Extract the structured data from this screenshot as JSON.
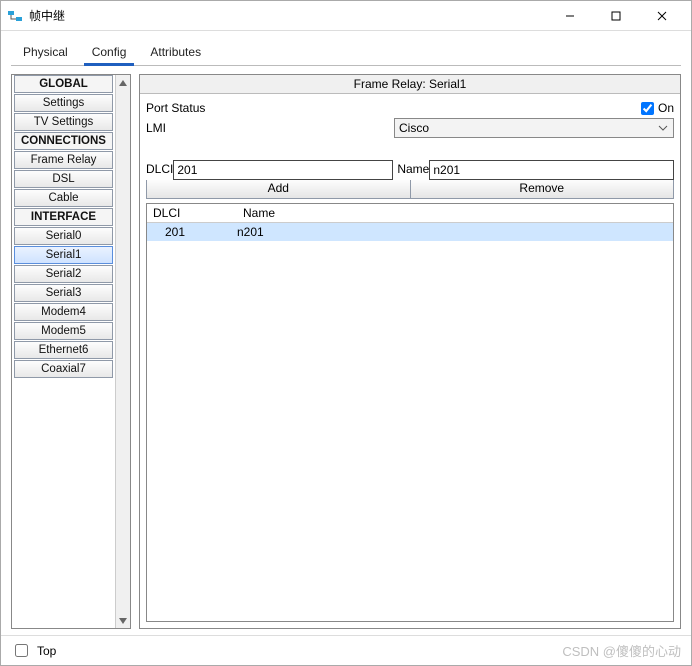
{
  "window": {
    "title": "帧中继"
  },
  "tabs": {
    "physical": "Physical",
    "config": "Config",
    "attributes": "Attributes",
    "active": "Config"
  },
  "sidebar": {
    "items": [
      {
        "kind": "header",
        "label": "GLOBAL"
      },
      {
        "kind": "item",
        "label": "Settings"
      },
      {
        "kind": "item",
        "label": "TV Settings"
      },
      {
        "kind": "header",
        "label": "CONNECTIONS"
      },
      {
        "kind": "item",
        "label": "Frame Relay"
      },
      {
        "kind": "item",
        "label": "DSL"
      },
      {
        "kind": "item",
        "label": "Cable"
      },
      {
        "kind": "header",
        "label": "INTERFACE"
      },
      {
        "kind": "item",
        "label": "Serial0"
      },
      {
        "kind": "item",
        "label": "Serial1",
        "selected": true
      },
      {
        "kind": "item",
        "label": "Serial2"
      },
      {
        "kind": "item",
        "label": "Serial3"
      },
      {
        "kind": "item",
        "label": "Modem4"
      },
      {
        "kind": "item",
        "label": "Modem5"
      },
      {
        "kind": "item",
        "label": "Ethernet6"
      },
      {
        "kind": "item",
        "label": "Coaxial7"
      }
    ]
  },
  "panel": {
    "title": "Frame Relay: Serial1",
    "port_status_label": "Port Status",
    "on_label": "On",
    "port_status_on": true,
    "lmi_label": "LMI",
    "lmi_value": "Cisco",
    "dlci_label": "DLCI",
    "dlci_value": "201",
    "name_label": "Name",
    "name_value": "n201",
    "add_label": "Add",
    "remove_label": "Remove",
    "table": {
      "header_dlci": "DLCI",
      "header_name": "Name",
      "rows": [
        {
          "dlci": "201",
          "name": "n201",
          "selected": true
        }
      ]
    }
  },
  "footer": {
    "top_label": "Top",
    "top_checked": false,
    "watermark": "CSDN @傻傻的心动"
  }
}
